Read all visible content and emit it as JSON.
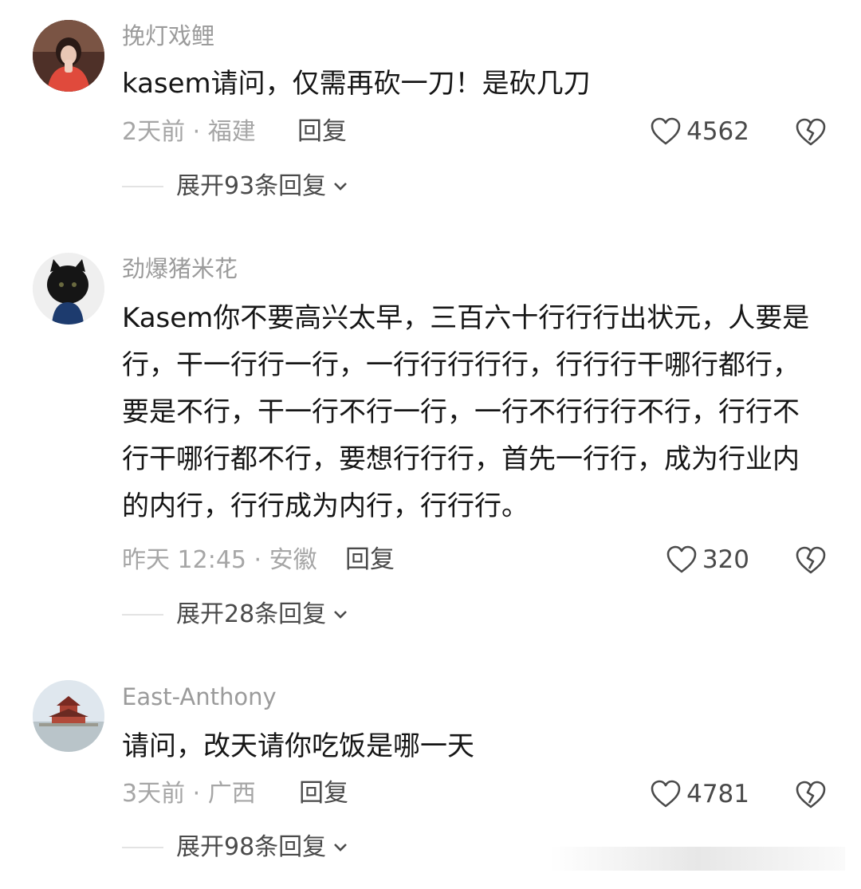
{
  "comments": [
    {
      "username": "挽灯戏鲤",
      "text": "kasem请问，仅需再砍一刀！是砍几刀",
      "time_location": "2天前 · 福建",
      "reply_label": "回复",
      "likes": "4562",
      "expand_label": "展开93条回复",
      "avatar_icon": "avatar-photo-icon"
    },
    {
      "username": "劲爆猪米花",
      "text": "Kasem你不要高兴太早，三百六十行行行出状元，人要是行，干一行行一行，一行行行行行，行行行干哪行都行，要是不行，干一行不行一行，一行不行行行不行，行行不行干哪行都不行，要想行行行，首先一行行，成为行业内的内行，行行成为内行，行行行。",
      "time_location": "昨天 12:45 · 安徽",
      "reply_label": "回复",
      "likes": "320",
      "expand_label": "展开28条回复",
      "avatar_icon": "avatar-cat-icon"
    },
    {
      "username": "East-Anthony",
      "text": "请问，改天请你吃饭是哪一天",
      "time_location": "3天前 · 广西",
      "reply_label": "回复",
      "likes": "4781",
      "expand_label": "展开98条回复",
      "avatar_icon": "avatar-pavilion-icon"
    }
  ],
  "icons": {
    "like": "heart-outline-icon",
    "dislike": "broken-heart-icon",
    "expand": "chevron-down-icon"
  }
}
